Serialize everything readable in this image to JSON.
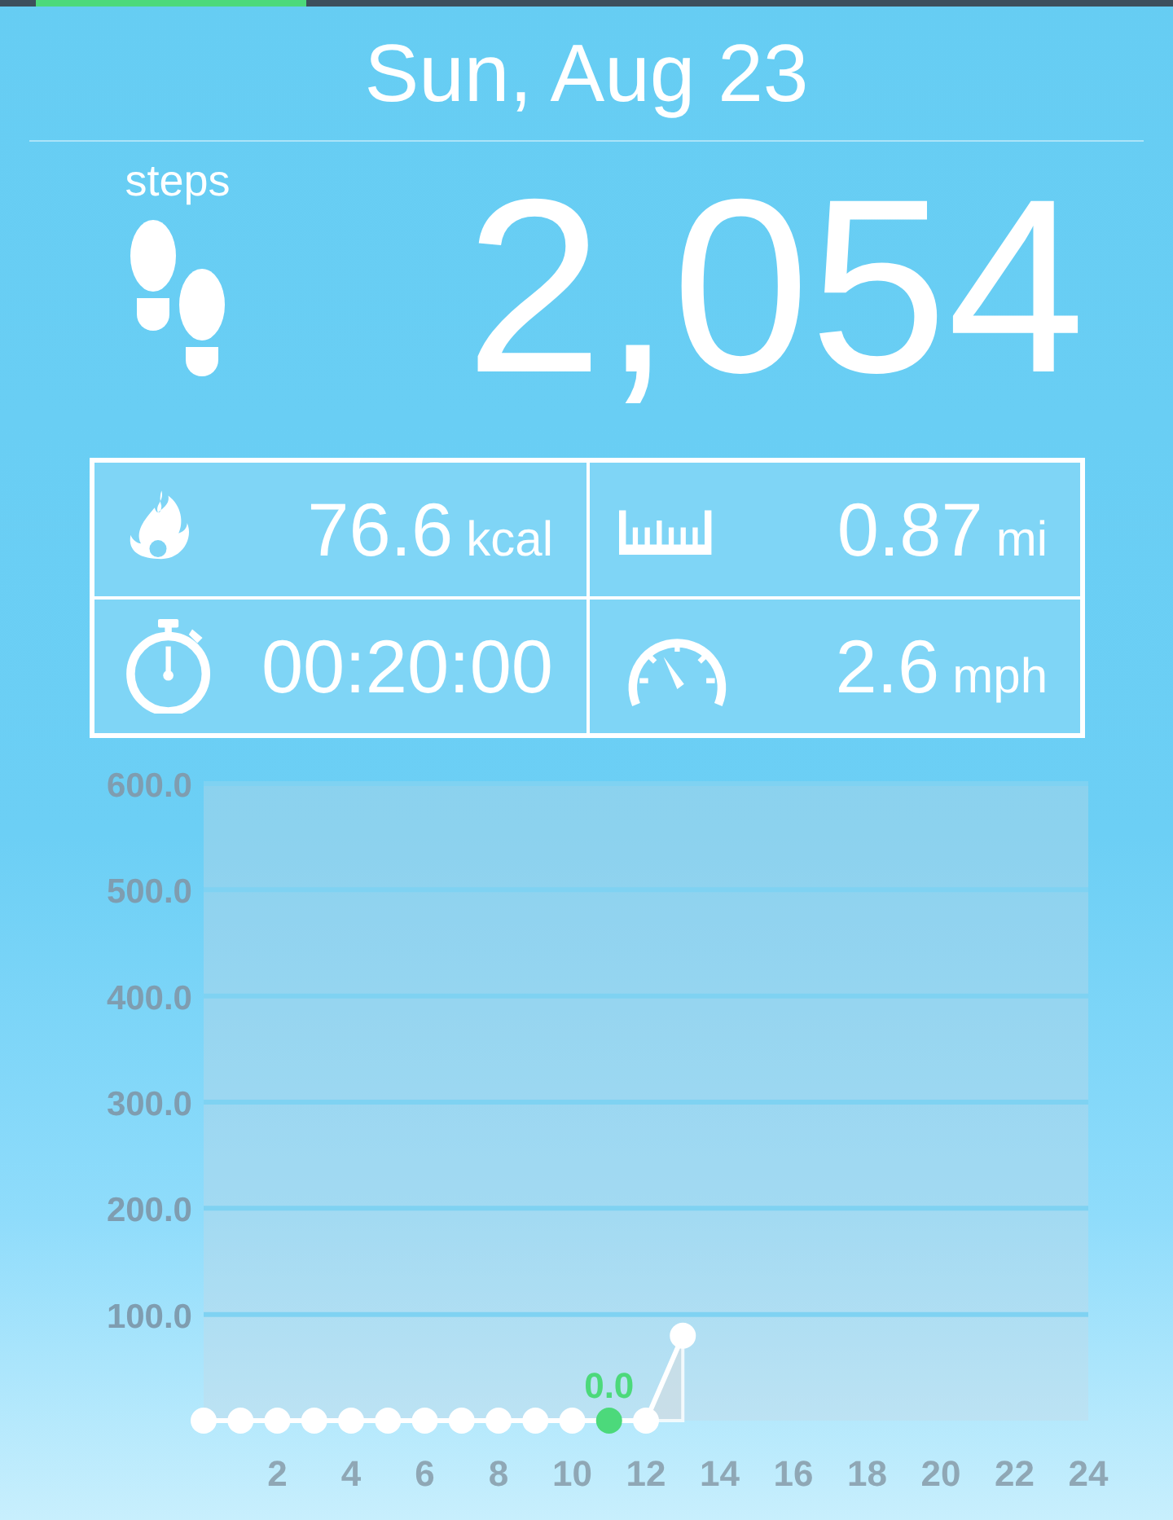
{
  "date": "Sun, Aug 23",
  "steps": {
    "label": "steps",
    "value": "2,054"
  },
  "stats": [
    {
      "kind": "calories",
      "value": "76.6",
      "unit": "kcal"
    },
    {
      "kind": "distance",
      "value": "0.87",
      "unit": "mi"
    },
    {
      "kind": "duration",
      "value": "00:20:00"
    },
    {
      "kind": "speed",
      "value": "2.6",
      "unit": "mph"
    }
  ],
  "chart": {
    "chart_data": {
      "type": "area",
      "x": [
        0,
        1,
        2,
        3,
        4,
        5,
        6,
        7,
        8,
        9,
        10,
        11,
        12,
        13
      ],
      "series": [
        {
          "color": "#ffffff",
          "values": [
            0,
            0,
            0,
            0,
            0,
            0,
            0,
            0,
            0,
            0,
            0,
            0,
            0,
            80
          ]
        }
      ],
      "grid": true,
      "xlim": [
        0,
        24
      ],
      "ylim": [
        0,
        600
      ],
      "xticks": [
        2,
        4,
        6,
        8,
        10,
        12,
        14,
        16,
        18,
        20,
        22,
        24
      ],
      "yticks": [
        {
          "value": 100,
          "label": "100.0"
        },
        {
          "value": 200,
          "label": "200.0"
        },
        {
          "value": 300,
          "label": "300.0"
        },
        {
          "value": 400,
          "label": "400.0"
        },
        {
          "value": 500,
          "label": "500.0"
        },
        {
          "value": 600,
          "label": "600.0"
        }
      ],
      "annotations": [
        {
          "x": 11,
          "y": 0,
          "text": "0.0"
        }
      ]
    }
  }
}
